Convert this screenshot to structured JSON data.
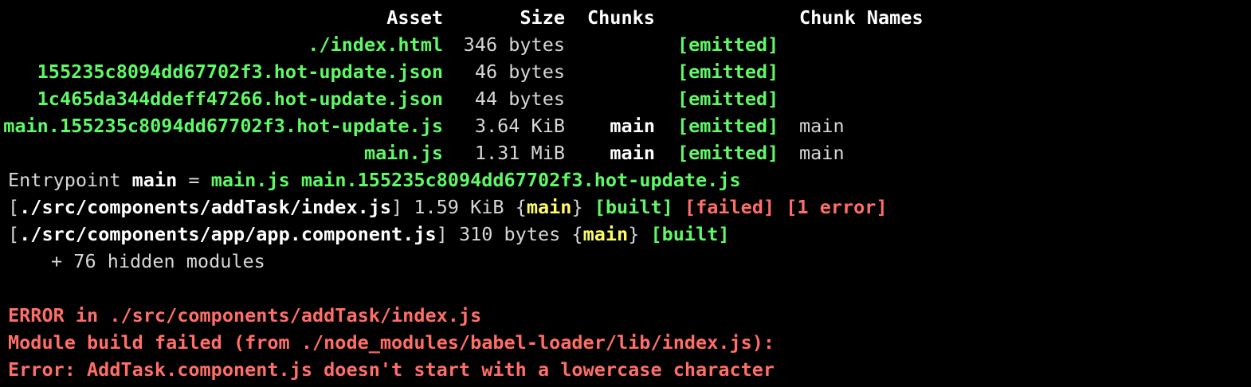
{
  "colors": {
    "background": "#000000",
    "default_text": "#d6d6d6",
    "bright_white": "#ffffff",
    "green": "#5ff967",
    "yellow": "#fffc67",
    "red": "#ff6e67"
  },
  "table": {
    "headers": {
      "asset": "Asset",
      "size": "Size",
      "chunks": "Chunks",
      "chunk_names": "Chunk Names"
    },
    "rows": [
      {
        "asset": "./index.html",
        "size": "346 bytes",
        "chunks": "",
        "flag": "[emitted]",
        "chunk_name": ""
      },
      {
        "asset": "155235c8094dd67702f3.hot-update.json",
        "size": "46 bytes",
        "chunks": "",
        "flag": "[emitted]",
        "chunk_name": ""
      },
      {
        "asset": "1c465da344ddeff47266.hot-update.json",
        "size": "44 bytes",
        "chunks": "",
        "flag": "[emitted]",
        "chunk_name": ""
      },
      {
        "asset": "main.155235c8094dd67702f3.hot-update.js",
        "size": "3.64 KiB",
        "chunks": "main",
        "flag": "[emitted]",
        "chunk_name": "main"
      },
      {
        "asset": "main.js",
        "size": "1.31 MiB",
        "chunks": "main",
        "flag": "[emitted]",
        "chunk_name": "main"
      }
    ]
  },
  "entrypoint": {
    "label": "Entrypoint ",
    "name": "main",
    "equals": " = ",
    "files": "main.js main.155235c8094dd67702f3.hot-update.js"
  },
  "modules": [
    {
      "open": "[",
      "path": "./src/components/addTask/index.js",
      "close": "]",
      "size": " 1.59 KiB ",
      "brace_open": "{",
      "chunk": "main",
      "brace_close": "}",
      "built": " [built]",
      "failed": " [failed]",
      "errors": " [1 error]"
    },
    {
      "open": "[",
      "path": "./src/components/app/app.component.js",
      "close": "]",
      "size": " 310 bytes ",
      "brace_open": "{",
      "chunk": "main",
      "brace_close": "}",
      "built": " [built]"
    }
  ],
  "hidden_modules": "+ 76 hidden modules",
  "errors": [
    "ERROR in ./src/components/addTask/index.js",
    "Module build failed (from ./node_modules/babel-loader/lib/index.js):",
    "Error: AddTask.component.js doesn't start with a lowercase character"
  ]
}
